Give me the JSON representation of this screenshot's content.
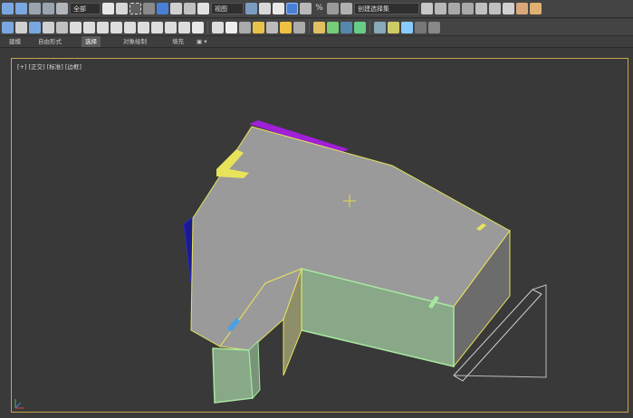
{
  "toolbar": {
    "filter_dropdown": "全部",
    "view_dropdown": "视图",
    "selection_set_dropdown": "创建选择集",
    "percent_snap_label": "%"
  },
  "ribbon": {
    "tabs": [
      {
        "label": "建模"
      },
      {
        "label": "自由形式"
      },
      {
        "label": "选择"
      },
      {
        "label": "对象绘制"
      },
      {
        "label": "填充"
      }
    ]
  },
  "viewport": {
    "label": "[+] [正交] [标准] [边框]"
  },
  "colors": {
    "accent": "#c8a64a",
    "floor": "#9a9a9a",
    "wall_yellow": "#e8e45a",
    "wall_green": "#a8e8a0",
    "wall_blue": "#1a1a8c",
    "wall_purple": "#a020d8",
    "wall_magenta": "#e0208c"
  }
}
